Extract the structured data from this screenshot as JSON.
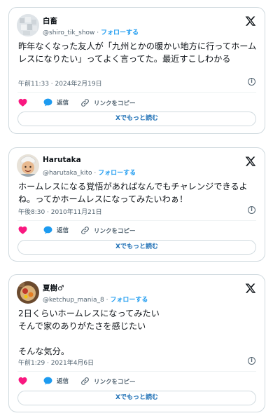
{
  "colors": {
    "accent": "#1d9bf0",
    "heart": "#f91880",
    "border": "#cfd9de",
    "muted": "#536471"
  },
  "tweets": [
    {
      "name": "白畜",
      "handle": "@shiro_tik_show",
      "separator": "·",
      "follow": "フォローする",
      "text": "昨年なくなった友人が「九州とかの暖かい地方に行ってホームレスになりたい」ってよく言ってた。最近すこしわかる",
      "time": "午前11:33 · 2024年2月19日",
      "reply": "返信",
      "copy_link": "リンクをコピー",
      "read_more": "Xでもっと読む",
      "avatar_icon": "blurred-avatar-icon"
    },
    {
      "name": "Harutaka",
      "handle": "@harutaka_kito",
      "separator": "·",
      "follow": "フォローする",
      "text": "ホームレスになる覚悟があればなんでもチャレンジできるよね。ってかホームレスになってみたいわぁ！",
      "time": "午後8:30 · 2010年11月21日",
      "reply": "返信",
      "copy_link": "リンクをコピー",
      "read_more": "Xでもっと読む",
      "avatar_icon": "person-photo-avatar-icon"
    },
    {
      "name": "夏樹♂",
      "handle": "@ketchup_mania_8",
      "separator": "·",
      "follow": "フォローする",
      "text_lines": [
        "2日くらいホームレスになってみたい",
        "そんで家のありがたさを感じたい",
        "",
        "そんな気分。"
      ],
      "time": "午前1:29 · 2021年4月6日",
      "reply": "返信",
      "copy_link": "リンクをコピー",
      "read_more": "Xでもっと読む",
      "avatar_icon": "food-photo-avatar-icon"
    }
  ]
}
